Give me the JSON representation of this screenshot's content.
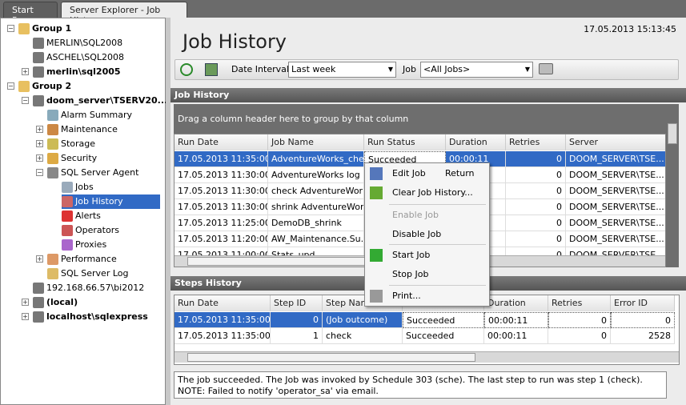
{
  "tabs": [
    {
      "label": "Start Page"
    },
    {
      "label": "Server Explorer - Job History"
    }
  ],
  "tree": [
    {
      "label": "Group 1",
      "bold": true,
      "icon": "folder-icon"
    },
    {
      "label": "MERLIN\\SQL2008",
      "icon": "server-warning-icon"
    },
    {
      "label": "ASCHEL\\SQL2008",
      "icon": "server-error-icon"
    },
    {
      "label": "merlin\\sql2005",
      "bold": true,
      "icon": "server-warning-icon"
    },
    {
      "label": "Group 2",
      "bold": true,
      "icon": "folder-icon"
    },
    {
      "label": "doom_server\\TSERV20...",
      "bold": true,
      "icon": "server-error-icon"
    },
    {
      "label": "Alarm Summary",
      "icon": "alarm-summary-icon"
    },
    {
      "label": "Maintenance",
      "icon": "maintenance-icon"
    },
    {
      "label": "Storage",
      "icon": "storage-icon"
    },
    {
      "label": "Security",
      "icon": "key-icon"
    },
    {
      "label": "SQL Server Agent",
      "icon": "agent-icon"
    },
    {
      "label": "Jobs",
      "icon": "jobs-icon"
    },
    {
      "label": "Job History",
      "icon": "job-history-icon",
      "selected": true
    },
    {
      "label": "Alerts",
      "icon": "alerts-icon"
    },
    {
      "label": "Operators",
      "icon": "operators-icon"
    },
    {
      "label": "Proxies",
      "icon": "proxies-icon"
    },
    {
      "label": "Performance",
      "icon": "performance-icon"
    },
    {
      "label": "SQL Server Log",
      "icon": "log-icon"
    },
    {
      "label": "192.168.66.57\\bi2012",
      "icon": "server-error-icon"
    },
    {
      "label": "(local)",
      "bold": true,
      "icon": "server-warning-icon"
    },
    {
      "label": "localhost\\sqlexpress",
      "bold": true,
      "icon": "server-warning-icon"
    }
  ],
  "header": {
    "title": "Job History",
    "timestamp": "17.05.2013 15:13:45"
  },
  "toolbar": {
    "date_interval_label": "Date Interval",
    "date_interval_value": "Last week",
    "job_label": "Job",
    "job_value": "<All Jobs>"
  },
  "job_history": {
    "section_title": "Job History",
    "group_hint": "Drag a column header here to group by that column",
    "columns": [
      "Run Date",
      "Job Name",
      "Run Status",
      "Duration",
      "Retries",
      "Server"
    ],
    "rows": [
      [
        "17.05.2013 11:35:00",
        "AdventureWorks_check",
        "Succeeded",
        "00:00:11",
        "0",
        "DOOM_SERVER\\TSE..."
      ],
      [
        "17.05.2013 11:30:00",
        "AdventureWorks log ...",
        "",
        "",
        "0",
        "DOOM_SERVER\\TSE..."
      ],
      [
        "17.05.2013 11:30:00",
        "check AdventureWorks",
        "",
        "",
        "0",
        "DOOM_SERVER\\TSE..."
      ],
      [
        "17.05.2013 11:30:00",
        "shrink AdventureWorks",
        "",
        "",
        "0",
        "DOOM_SERVER\\TSE..."
      ],
      [
        "17.05.2013 11:25:00",
        "DemoDB_shrink",
        "",
        "",
        "0",
        "DOOM_SERVER\\TSE..."
      ],
      [
        "17.05.2013 11:20:00",
        "AW_Maintenance.Su...",
        "",
        "",
        "0",
        "DOOM_SERVER\\TSE..."
      ],
      [
        "17.05.2013 11:00:00",
        "Stats_upd",
        "",
        "",
        "0",
        "DOOM_SERVER\\TSE..."
      ]
    ]
  },
  "steps_history": {
    "section_title": "Steps History",
    "columns": [
      "Run Date",
      "Step ID",
      "Step Name",
      "Run Status",
      "Duration",
      "Retries",
      "Error ID"
    ],
    "rows": [
      [
        "17.05.2013 11:35:00",
        "0",
        "(Job outcome)",
        "Succeeded",
        "00:00:11",
        "0",
        "0"
      ],
      [
        "17.05.2013 11:35:00",
        "1",
        "check",
        "Succeeded",
        "00:00:11",
        "0",
        "2528"
      ]
    ]
  },
  "context_menu": [
    {
      "label": "Edit Job",
      "shortcut": "Return",
      "icon": "edit-icon"
    },
    {
      "label": "Clear Job History...",
      "icon": "broom-icon"
    },
    {
      "label": "Enable Job",
      "disabled": true
    },
    {
      "label": "Disable Job"
    },
    {
      "label": "Start Job",
      "icon": "start-job-icon"
    },
    {
      "label": "Stop Job"
    },
    {
      "label": "Print...",
      "icon": "printer-icon"
    }
  ],
  "status_message": "The job succeeded.  The Job was invoked by Schedule 303 (sche).  The last step to run was step 1 (check).  NOTE: Failed to notify 'operator_sa' via email."
}
